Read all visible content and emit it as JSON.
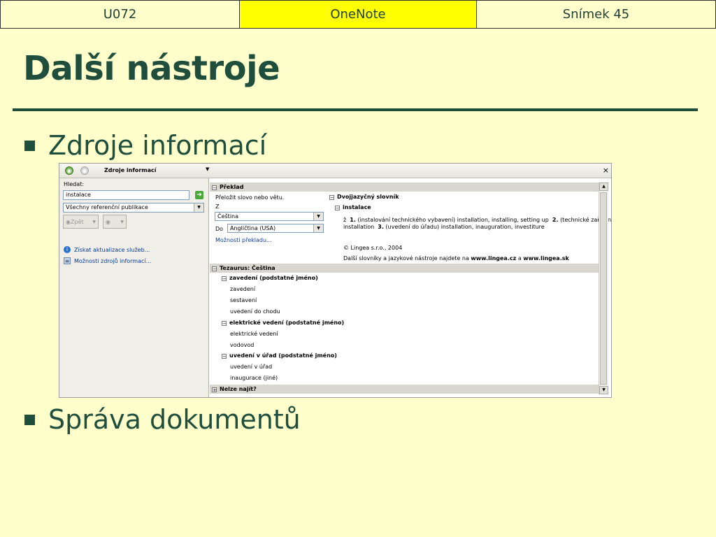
{
  "header": {
    "left": "U072",
    "center": "OneNote",
    "right": "Snímek 45"
  },
  "slide": {
    "title": "Další nástroje",
    "bullets": [
      "Zdroje informací",
      "Správa dokumentů"
    ]
  },
  "research_pane": {
    "toolbar_title": "Zdroje informací",
    "search_label": "Hledat:",
    "search_value": "instalace",
    "source_select": "Všechny referenční publikace",
    "back_button": "Zpět",
    "links": [
      "Získat aktualizace služeb...",
      "Možnosti zdrojů informací..."
    ],
    "translation": {
      "header": "Překlad",
      "prompt": "Přeložit slovo nebo větu.",
      "from_label": "Z",
      "from_value": "Čeština",
      "to_label": "Do",
      "to_value": "Angličtina (USA)",
      "options_link": "Možnosti překladu...",
      "dict_title": "Dvojjazyčný slovník",
      "dict_word": "instalace",
      "dict_pos": "ž",
      "def_1_num": "1.",
      "def_1_text": "(instalování technického vybavení) installation, installing, setting up",
      "def_2_num": "2.",
      "def_2_text": "(technické zařízení)",
      "def_2b_text": "installation",
      "def_3_num": "3.",
      "def_3_text": "(uvedení do úřadu) installation, inauguration, investiture",
      "copyright": "© Lingea s.r.o., 2004",
      "more_prefix": "Další slovníky a jazykové nástroje najdete na",
      "more_link1": "www.lingea.cz",
      "more_and": "a",
      "more_link2": "www.lingea.sk"
    },
    "thesaurus": {
      "header": "Tezaurus: Čeština",
      "groups": [
        {
          "title": "zavedení (podstatné jméno)",
          "items": [
            "zavedení",
            "sestavení",
            "uvedení do chodu"
          ]
        },
        {
          "title": "elektrické vedení (podstatné jméno)",
          "items": [
            "elektrické vedení",
            "vodovod"
          ]
        },
        {
          "title": "uvedení v úřad (podstatné jméno)",
          "items": [
            "uvedení v úřad",
            "inaugurace (jiné)"
          ]
        }
      ]
    },
    "not_found": "Nelze najít?"
  }
}
